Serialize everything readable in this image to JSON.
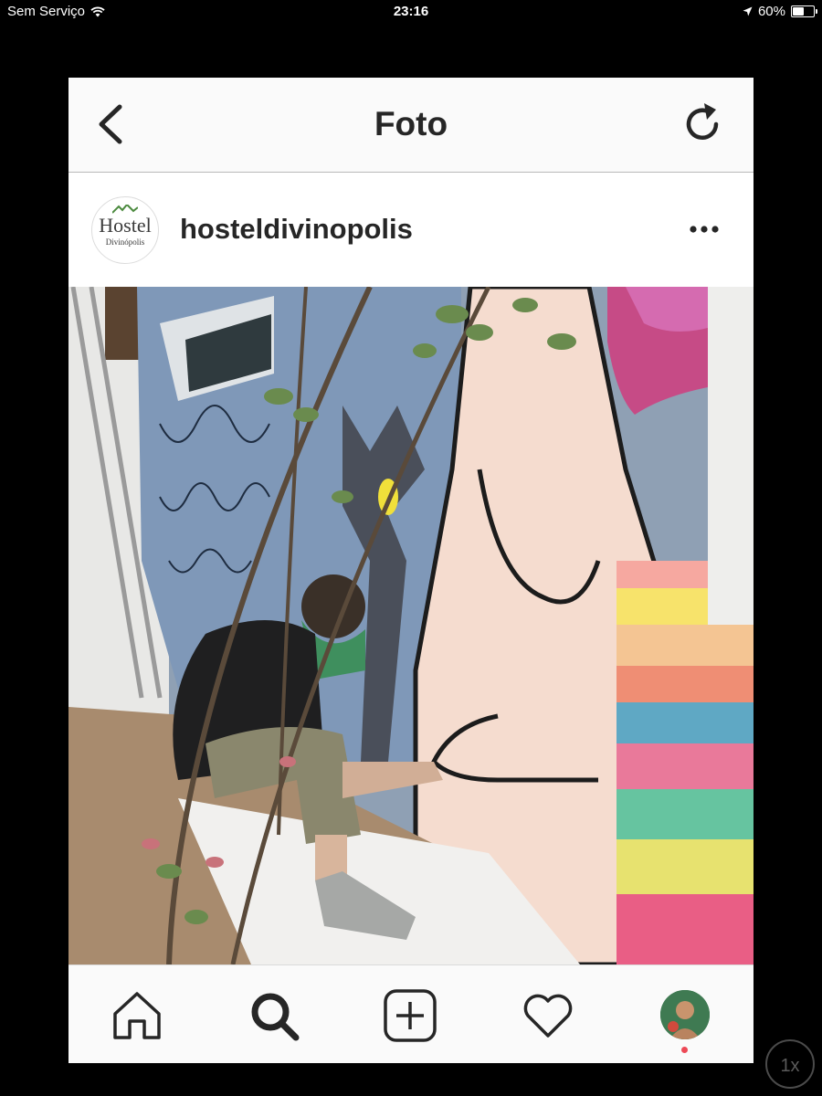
{
  "status_bar": {
    "carrier": "Sem Serviço",
    "time": "23:16",
    "battery_percent": "60%",
    "battery_level": 0.6
  },
  "navbar": {
    "title": "Foto",
    "back_icon": "chevron-left-icon",
    "refresh_icon": "refresh-icon"
  },
  "post": {
    "username": "hosteldivinopolis",
    "avatar_text": "Hostel",
    "avatar_subtext": "Divinópolis",
    "more_icon": "ellipsis-icon"
  },
  "tab_bar": {
    "items": [
      "home-icon",
      "search-icon",
      "add-post-icon",
      "heart-icon",
      "profile-avatar"
    ],
    "notification_color": "#ed4956"
  },
  "zoom_button": {
    "label": "1x"
  }
}
